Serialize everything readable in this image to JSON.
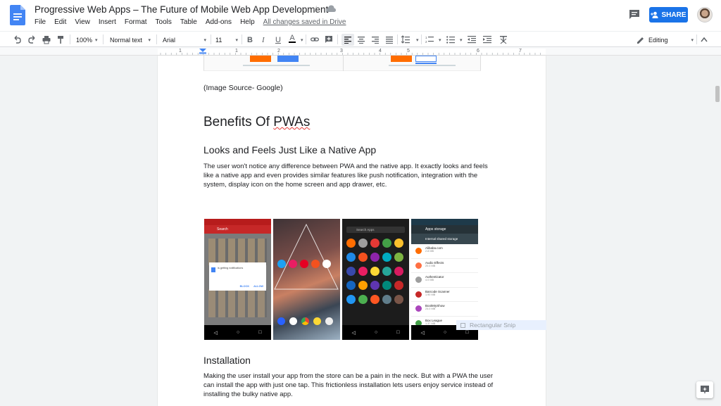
{
  "doc": {
    "title": "Progressive Web Apps – The Future of Mobile Web App Development",
    "saved_status": "All changes saved in Drive",
    "share_label": "SHARE"
  },
  "menu": [
    "File",
    "Edit",
    "View",
    "Insert",
    "Format",
    "Tools",
    "Table",
    "Add-ons",
    "Help"
  ],
  "toolbar": {
    "zoom": "100%",
    "style": "Normal text",
    "font": "Arial",
    "size": "11",
    "mode": "Editing"
  },
  "ruler": [
    "1",
    "1",
    "2",
    "3",
    "4",
    "5",
    "6",
    "7"
  ],
  "content": {
    "caption": "(Image Source- Google)",
    "heading1_prefix": "Benefits Of ",
    "heading1_word": "PWAs",
    "heading2a": "Looks and Feels Just Like a Native App",
    "para1": "The user won't notice any difference between PWA and the native app. It exactly looks and feels like a native app and even provides similar features like push notification, integration with the system, display icon on the home screen and app drawer, etc.",
    "heading2b": "Installation",
    "para2": "Making the user install your app from the store can be a pain in the neck. But with a PWA the user can install the app with just one tap. This frictionless installation lets users enjoy service instead of installing the bulky native app."
  },
  "phones": {
    "p1": {
      "search": "Search",
      "notif": "is getting notifications",
      "btn1": "BLOCK",
      "btn2": "ALLOW"
    },
    "p3": {
      "search": "Search Apps"
    },
    "p4": {
      "title": "Apps storage",
      "subtitle": "Internal shared storage",
      "apps": [
        {
          "name": "Alibaba.com",
          "size": "2.8 MB"
        },
        {
          "name": "Audio Effects",
          "size": "20.0 MB"
        },
        {
          "name": "Authenticator",
          "size": "4.0 MB"
        },
        {
          "name": "Barcode Scanner",
          "size": "1.90 MB"
        },
        {
          "name": "BookMyShow",
          "size": "24.0 MB"
        },
        {
          "name": "Box League",
          "size": "1.37 MB"
        }
      ]
    }
  },
  "snip_label": "Rectangular Snip",
  "colors": {
    "accent": "#1a73e8",
    "squiggle": "#e53935"
  }
}
